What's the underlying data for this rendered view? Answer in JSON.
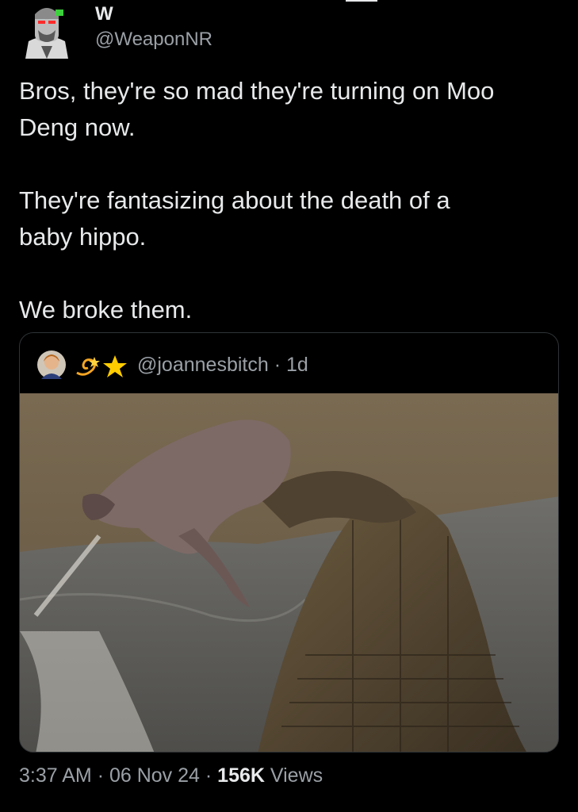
{
  "author": {
    "name": "W",
    "handle": "@WeaponNR"
  },
  "tweet": {
    "text": "Bros, they're so mad they're turning on Moo\nDeng now.\n\nThey're fantasizing about the death of a\nbaby hippo.\n\nWe broke them."
  },
  "quote": {
    "handle": "@joannesbitch",
    "separator": "·",
    "time": "1d",
    "emojis": [
      "dizzy-emoji",
      "star-emoji"
    ],
    "image_alt": "Crocodile seizing a baby hippo at the edge of a muddy river"
  },
  "meta": {
    "time": "3:37 AM",
    "sep1": "·",
    "date": "06 Nov 24",
    "sep2": "·",
    "views_count": "156K",
    "views_label": "Views"
  },
  "colors": {
    "background": "#000000",
    "text": "#e7e9ea",
    "secondary": "#9aa0a6",
    "border": "#2f3336"
  }
}
